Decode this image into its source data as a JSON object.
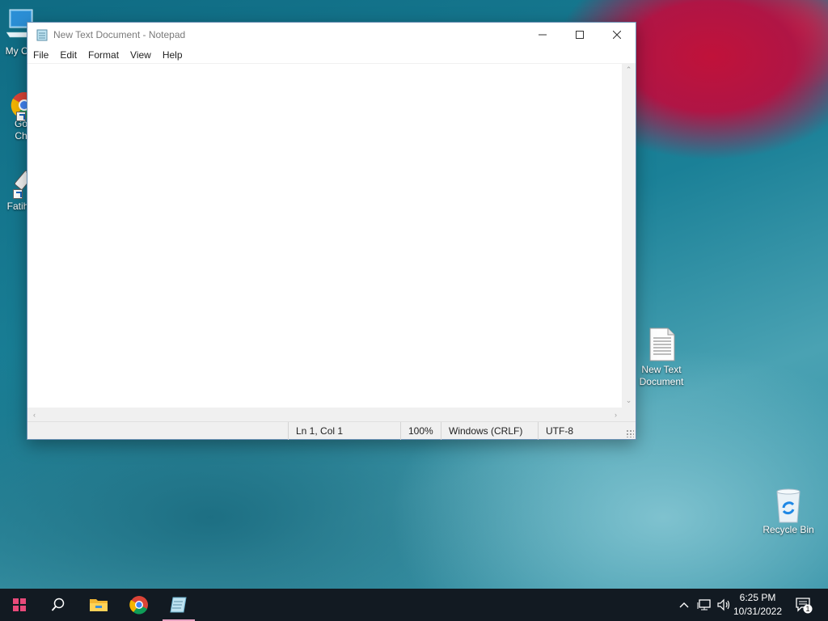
{
  "desktop": {
    "icons": [
      {
        "label": "My Co"
      },
      {
        "label1": "Go",
        "label2": "Ch"
      },
      {
        "label": "Fatih"
      },
      {
        "label1": "New Text",
        "label2": "Document"
      },
      {
        "label": "Recycle Bin"
      }
    ]
  },
  "notepad": {
    "title": "New Text Document - Notepad",
    "menu": [
      "File",
      "Edit",
      "Format",
      "View",
      "Help"
    ],
    "content": "",
    "status": {
      "position": "Ln 1, Col 1",
      "zoom": "100%",
      "line_ending": "Windows (CRLF)",
      "encoding": "UTF-8"
    }
  },
  "taskbar": {
    "time": "6:25 PM",
    "date": "10/31/2022",
    "notification_count": "1",
    "icons": [
      "start-icon",
      "search-icon",
      "file-explorer-icon",
      "chrome-icon",
      "notepad-icon"
    ]
  },
  "colors": {
    "taskbar_bg": "#121a22",
    "active_indicator": "#e7a3c2",
    "window_border": "#6a8fb3"
  }
}
